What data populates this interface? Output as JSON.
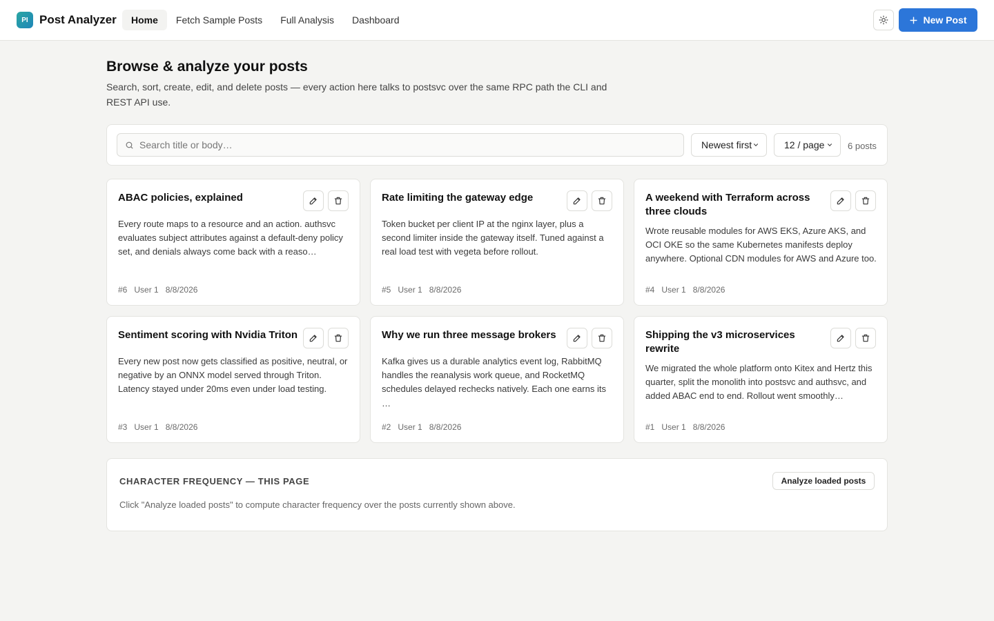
{
  "app": {
    "logo_text": "PI",
    "name": "Post Analyzer"
  },
  "nav": {
    "tabs": [
      {
        "label": "Home",
        "active": true
      },
      {
        "label": "Fetch Sample Posts",
        "active": false
      },
      {
        "label": "Full Analysis",
        "active": false
      },
      {
        "label": "Dashboard",
        "active": false
      }
    ]
  },
  "header": {
    "theme_icon": "sun-icon",
    "new_post_label": "New Post"
  },
  "page": {
    "title": "Browse & analyze your posts",
    "subtitle": "Search, sort, create, edit, and delete posts — every action here talks to postsvc over the same RPC path the CLI and REST API use."
  },
  "toolbar": {
    "search_placeholder": "Search title or body…",
    "sort_value": "Newest first",
    "per_page_value": "12 / page",
    "count": "6 posts"
  },
  "posts": [
    {
      "title": "ABAC policies, explained",
      "body": "Every route maps to a resource and an action. authsvc evaluates subject attributes against a default-deny policy set, and denials always come back with a reaso…",
      "id": "#6",
      "user": "User 1",
      "date": "8/8/2026"
    },
    {
      "title": "Rate limiting the gateway edge",
      "body": "Token bucket per client IP at the nginx layer, plus a second limiter inside the gateway itself. Tuned against a real load test with vegeta before rollout.",
      "id": "#5",
      "user": "User 1",
      "date": "8/8/2026"
    },
    {
      "title": "A weekend with Terraform across three clouds",
      "body": "Wrote reusable modules for AWS EKS, Azure AKS, and OCI OKE so the same Kubernetes manifests deploy anywhere. Optional CDN modules for AWS and Azure too.",
      "id": "#4",
      "user": "User 1",
      "date": "8/8/2026"
    },
    {
      "title": "Sentiment scoring with Nvidia Triton",
      "body": "Every new post now gets classified as positive, neutral, or negative by an ONNX model served through Triton. Latency stayed under 20ms even under load testing.",
      "id": "#3",
      "user": "User 1",
      "date": "8/8/2026"
    },
    {
      "title": "Why we run three message brokers",
      "body": "Kafka gives us a durable analytics event log, RabbitMQ handles the reanalysis work queue, and RocketMQ schedules delayed rechecks natively. Each one earns its …",
      "id": "#2",
      "user": "User 1",
      "date": "8/8/2026"
    },
    {
      "title": "Shipping the v3 microservices rewrite",
      "body": "We migrated the whole platform onto Kitex and Hertz this quarter, split the monolith into postsvc and authsvc, and added ABAC end to end. Rollout went smoothly…",
      "id": "#1",
      "user": "User 1",
      "date": "8/8/2026"
    }
  ],
  "char_freq": {
    "title": "CHARACTER FREQUENCY — THIS PAGE",
    "button_label": "Analyze loaded posts",
    "hint": "Click \"Analyze loaded posts\" to compute character frequency over the posts currently shown above."
  },
  "colors": {
    "accent": "#2c76d9",
    "background": "#f4f4f2",
    "card": "#ffffff",
    "border": "#e4e4e0"
  }
}
